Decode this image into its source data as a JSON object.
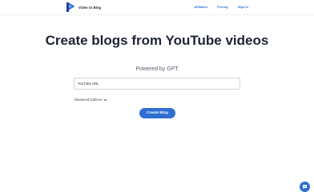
{
  "brand": {
    "name": "Video to Blog",
    "logo_icon": "play-p-logo-icon",
    "accent": "#2f6fd1"
  },
  "nav": {
    "links": [
      "Affiliates",
      "Pricing",
      "Sign In"
    ],
    "link_color": "#2f73d6"
  },
  "hero": {
    "title": "Create blogs from YouTube videos",
    "subtitle": "Powered by GPT"
  },
  "form": {
    "url_placeholder": "YouTube URL",
    "advanced_label": "Advanced Options",
    "advanced_icon": "chevron-down-icon",
    "submit_label": "Create Blog"
  },
  "chat_widget": {
    "icon": "chat-bubble-icon",
    "color": "#2f6fd1"
  }
}
